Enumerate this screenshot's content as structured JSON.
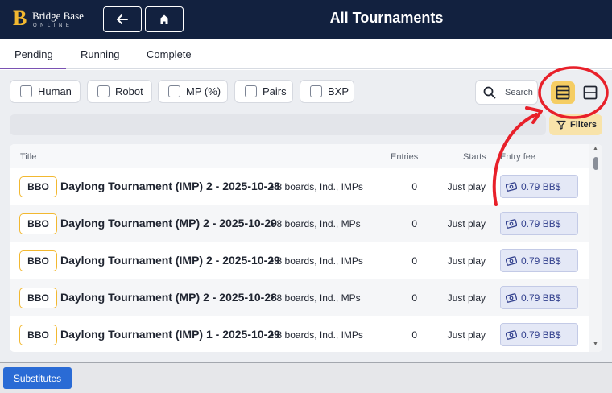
{
  "header": {
    "logo_title": "Bridge Base",
    "logo_subtitle": "ONLINE",
    "title": "All Tournaments",
    "icons": [
      "back-arrow-icon",
      "home-icon"
    ]
  },
  "tabs": [
    {
      "label": "Pending",
      "active": true
    },
    {
      "label": "Running",
      "active": false
    },
    {
      "label": "Complete",
      "active": false
    }
  ],
  "filters": {
    "chips": [
      {
        "label": "Human"
      },
      {
        "label": "Robot"
      },
      {
        "label": "MP (%)"
      },
      {
        "label": "Pairs"
      },
      {
        "label": "BXP"
      }
    ],
    "search_label": "Search",
    "filters_label": "Filters"
  },
  "table": {
    "headers": {
      "title": "Title",
      "entries": "Entries",
      "starts": "Starts",
      "fee": "Entry fee"
    },
    "rows": [
      {
        "badge": "BBO",
        "title": "Daylong Tournament (IMP) 2 - 2025-10-28",
        "meta": "• 8 boards, Ind., IMPs",
        "entries": "0",
        "starts": "Just play",
        "fee": "0.79 BB$"
      },
      {
        "badge": "BBO",
        "title": "Daylong Tournament (MP) 2 - 2025-10-29",
        "meta": "• 8 boards, Ind., MPs",
        "entries": "0",
        "starts": "Just play",
        "fee": "0.79 BB$"
      },
      {
        "badge": "BBO",
        "title": "Daylong Tournament (IMP) 2 - 2025-10-29",
        "meta": "• 8 boards, Ind., IMPs",
        "entries": "0",
        "starts": "Just play",
        "fee": "0.79 BB$"
      },
      {
        "badge": "BBO",
        "title": "Daylong Tournament (MP) 2 - 2025-10-28",
        "meta": "• 8 boards, Ind., MPs",
        "entries": "0",
        "starts": "Just play",
        "fee": "0.79 BB$"
      },
      {
        "badge": "BBO",
        "title": "Daylong Tournament (IMP) 1 - 2025-10-29",
        "meta": "• 8 boards, Ind., IMPs",
        "entries": "0",
        "starts": "Just play",
        "fee": "0.79 BB$"
      }
    ]
  },
  "bottom": {
    "substitutes_label": "Substitutes"
  },
  "colors": {
    "header_bg": "#12213f",
    "accent_gold": "#f2b830",
    "tab_underline": "#7a52b3",
    "primary_button": "#2a6bd5",
    "annotation_red": "#e8202a"
  }
}
